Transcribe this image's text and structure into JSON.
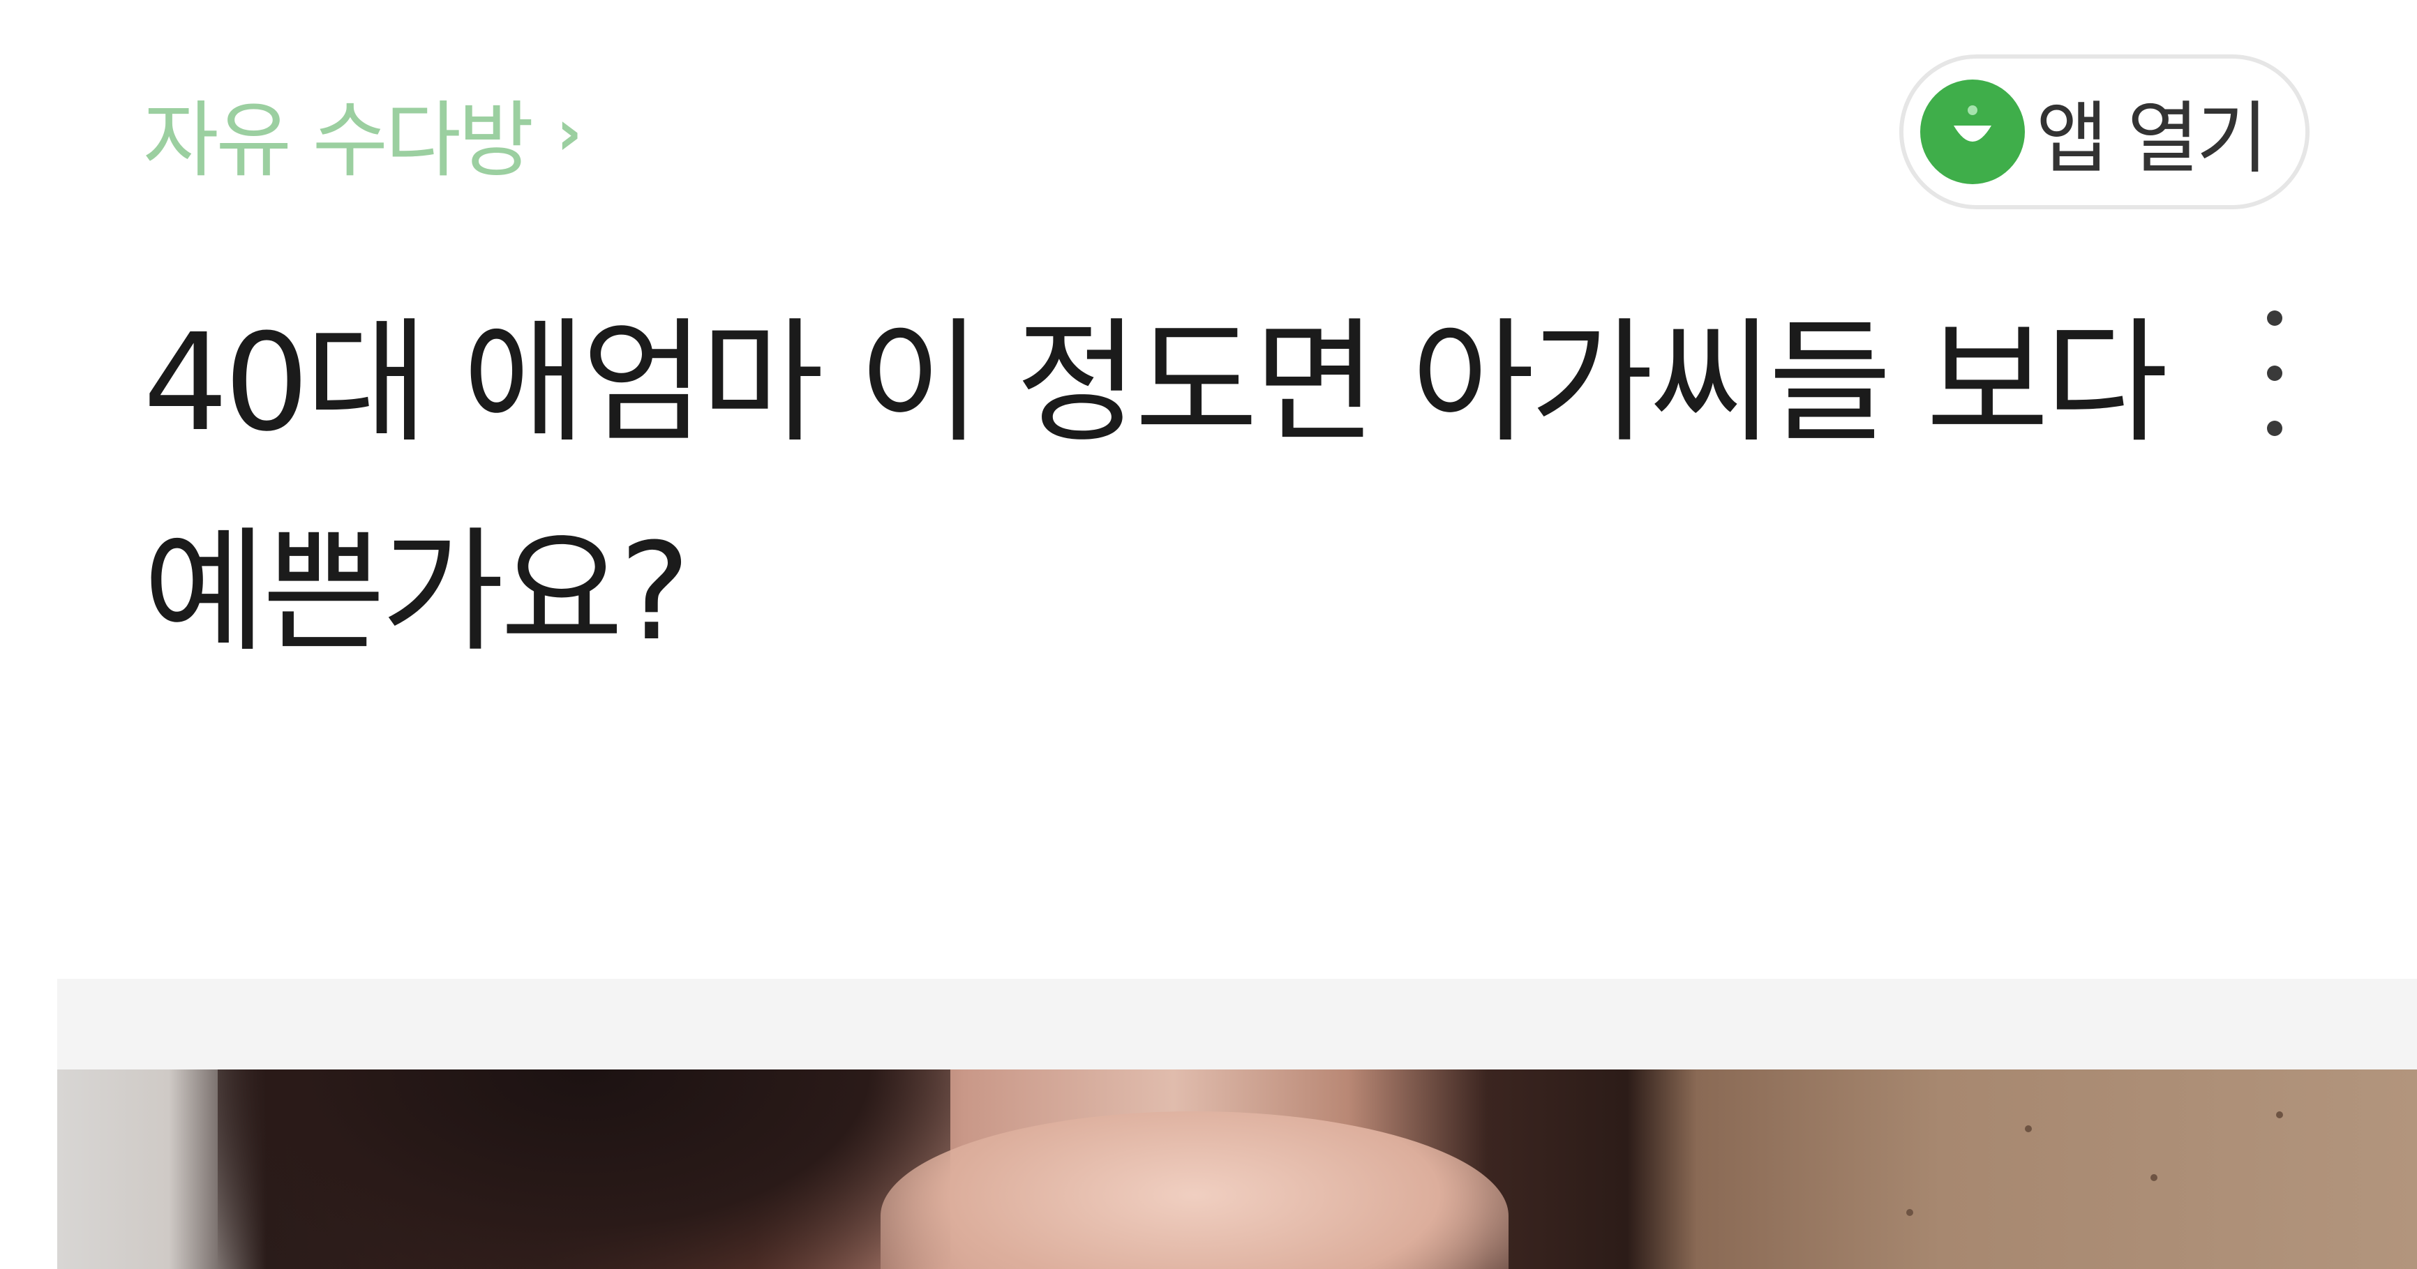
{
  "header": {
    "breadcrumb": "자유 수다방",
    "breadcrumb_chevron": "›",
    "app_open_label": "앱 열기"
  },
  "post": {
    "title": "40대 애엄마 이 정도면 아가씨들 보다 예쁜가요?"
  },
  "icons": {
    "app_logo": "app-logo-icon",
    "more": "more-vertical-icon",
    "chevron": "chevron-right-icon"
  },
  "colors": {
    "brand_green": "#3fae4a",
    "breadcrumb_text": "#9bcfa0",
    "title_text": "#1b1b1b"
  }
}
